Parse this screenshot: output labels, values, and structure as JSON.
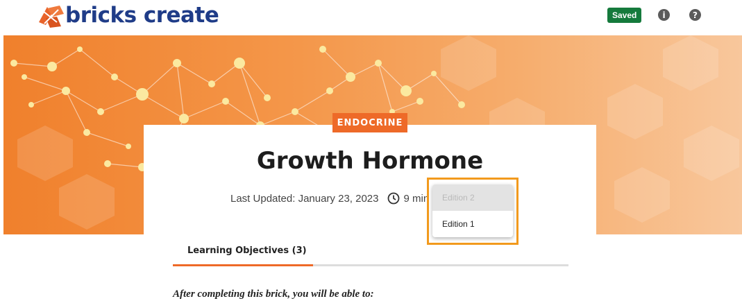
{
  "header": {
    "brand_name": "bricks create",
    "save_status": "Saved",
    "info_icon": "info-icon",
    "help_icon": "help-icon",
    "colors": {
      "brand": "#1f3c88",
      "logo_accent": "#e8632b",
      "saved": "#157a3c"
    }
  },
  "brick": {
    "category": "ENDOCRINE",
    "title": "Growth Hormone",
    "last_updated": "Last Updated: January 23, 2023",
    "duration": "9 min",
    "clock_icon": "clock-icon",
    "colors": {
      "accent": "#ee6a28",
      "banner": "#f4974a"
    }
  },
  "edition_dropdown": {
    "options": [
      {
        "label": "Edition 2",
        "disabled": true
      },
      {
        "label": "Edition 1",
        "disabled": false
      }
    ],
    "highlight_color": "#f29a1d"
  },
  "tabs": [
    {
      "label": "Learning Objectives (3)",
      "active": true
    }
  ],
  "objectives": {
    "intro": "After completing this brick, you will be able to:"
  }
}
